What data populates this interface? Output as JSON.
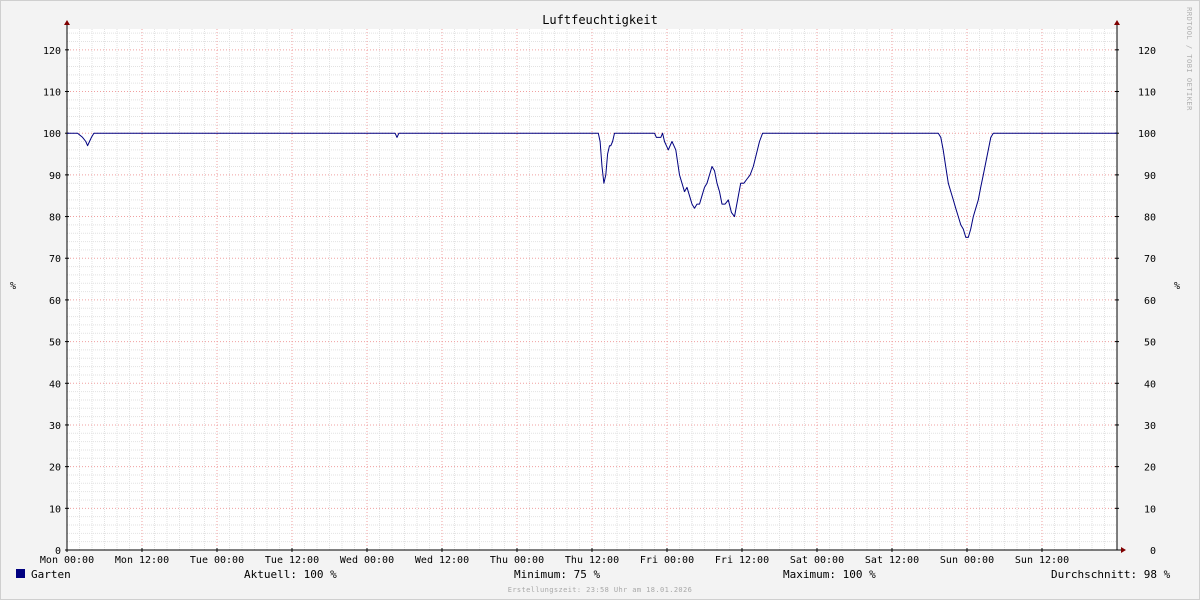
{
  "chart_data": {
    "type": "line",
    "title": "Luftfeuchtigkeit",
    "ylabel": "%",
    "ylim": [
      0,
      125
    ],
    "ytick_step": 10,
    "xlim": [
      "Mon 00:00",
      "Mon 00:00 (+7d)"
    ],
    "x_unit": "hours",
    "xtick_labels": [
      "Mon 00:00",
      "Mon 12:00",
      "Tue 00:00",
      "Tue 12:00",
      "Wed 00:00",
      "Wed 12:00",
      "Thu 00:00",
      "Thu 12:00",
      "Fri 00:00",
      "Fri 12:00",
      "Sat 00:00",
      "Sat 12:00",
      "Sun 00:00",
      "Sun 12:00"
    ],
    "grid": true,
    "series": [
      {
        "name": "Garten",
        "color": "#000080",
        "x": [
          0,
          1.7,
          2.5,
          3.0,
          3.3,
          3.6,
          3.9,
          4.3,
          52.5,
          52.8,
          53.1,
          53.4,
          85.0,
          85.3,
          85.6,
          85.9,
          86.2,
          86.5,
          86.8,
          87.0,
          87.3,
          87.6,
          88.0,
          88.6,
          89.0,
          89.4,
          94.0,
          94.3,
          94.6,
          95.0,
          95.3,
          95.6,
          95.9,
          96.2,
          96.5,
          96.8,
          97.1,
          97.4,
          98.0,
          98.8,
          99.2,
          99.6,
          100.0,
          100.4,
          100.8,
          101.2,
          101.6,
          102.0,
          102.4,
          102.8,
          103.2,
          103.6,
          104.0,
          104.4,
          104.8,
          105.3,
          105.8,
          106.3,
          106.8,
          107.3,
          107.8,
          108.3,
          108.8,
          109.3,
          109.8,
          110.3,
          110.8,
          111.3,
          111.8,
          112.3,
          112.8,
          113.3,
          113.8,
          114.3,
          114.8,
          115.3,
          115.8,
          116.3,
          116.8,
          117.3,
          117.8,
          118.3,
          118.8,
          119.3,
          119.8,
          120.3,
          120.8,
          121.3,
          121.8,
          122.3,
          122.8,
          123.3,
          123.8,
          124.3,
          124.8,
          125.3,
          125.8,
          126.2,
          126.6,
          127.0,
          127.4,
          127.8,
          128.2,
          128.6,
          129.0,
          129.4,
          129.8,
          130.2,
          130.6,
          131.0,
          131.4,
          131.8,
          132.2,
          132.6,
          133.0,
          133.4,
          133.8,
          134.2,
          134.6,
          135.0,
          135.4,
          135.8,
          136.2,
          136.6,
          137.0,
          137.4,
          137.8,
          138.2,
          138.6,
          139.0,
          139.4,
          139.8,
          140.2,
          140.6,
          141.0,
          141.4,
          141.8,
          142.2,
          142.6,
          143.0,
          143.4,
          143.8,
          144.2,
          144.6,
          145.0,
          145.4,
          145.8,
          146.2,
          146.6,
          147.0,
          147.4,
          147.8,
          148.2,
          148.6,
          149.0,
          149.4,
          149.8,
          150.2,
          150.6,
          151.0,
          151.4,
          151.8,
          152.2,
          152.6,
          153.0,
          168
        ],
        "values": [
          100,
          100,
          99,
          98,
          97,
          98,
          99,
          100,
          100,
          99,
          100,
          100,
          100,
          98,
          92,
          88,
          90,
          95,
          97,
          97,
          98,
          100,
          100,
          100,
          100,
          100,
          100,
          99,
          99,
          99,
          100,
          98,
          97,
          96,
          97,
          98,
          97,
          96,
          90,
          86,
          87,
          85,
          83,
          82,
          83,
          83,
          85,
          87,
          88,
          90,
          92,
          91,
          88,
          86,
          83,
          83,
          84,
          81,
          80,
          84,
          88,
          88,
          89,
          90,
          92,
          95,
          98,
          100,
          100,
          100,
          100,
          100,
          100,
          100,
          100,
          100,
          100,
          100,
          100,
          100,
          100,
          100,
          100,
          100,
          100,
          100,
          100,
          100,
          100,
          100,
          100,
          100,
          100,
          100,
          100,
          100,
          100,
          100,
          100,
          100,
          100,
          100,
          100,
          100,
          100,
          100,
          100,
          100,
          100,
          100,
          100,
          100,
          100,
          100,
          100,
          100,
          100,
          100,
          100,
          100,
          100,
          100,
          100,
          100,
          100,
          100,
          100,
          100,
          100,
          100,
          100,
          99,
          96,
          92,
          88,
          86,
          84,
          82,
          80,
          78,
          77,
          75,
          75,
          77,
          80,
          82,
          84,
          87,
          90,
          93,
          96,
          99,
          100,
          100,
          100,
          100,
          100,
          100,
          100,
          100,
          100,
          100,
          100,
          100,
          100,
          100
        ]
      }
    ]
  },
  "legend": {
    "series_label": "Garten",
    "series_color": "#000080",
    "aktuell": "Aktuell: 100 %",
    "minimum": "Minimum:  75 %",
    "maximum": "Maximum: 100 %",
    "durchschnitt": "Durchschnitt:  98 %"
  },
  "watermark": "RRDTOOL / TOBI OETIKER",
  "created": "Erstellungszeit: 23:58 Uhr am 18.01.2026"
}
